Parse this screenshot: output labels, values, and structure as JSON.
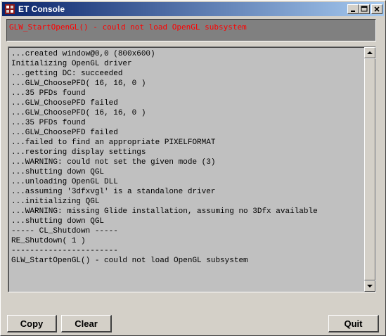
{
  "window": {
    "title": "ET Console",
    "icon": "et-app-icon",
    "controls": [
      "minimize-icon",
      "maximize-icon",
      "close-icon"
    ]
  },
  "error_bar": {
    "text": "GLW_StartOpenGL() - could not load OpenGL subsystem",
    "color": "#ff0000"
  },
  "console": {
    "lines": [
      "...created window@0,0 (800x600)",
      "Initializing OpenGL driver",
      "...getting DC: succeeded",
      "...GLW_ChoosePFD( 16, 16, 0 )",
      "...35 PFDs found",
      "...GLW_ChoosePFD failed",
      "...GLW_ChoosePFD( 16, 16, 0 )",
      "...35 PFDs found",
      "...GLW_ChoosePFD failed",
      "...failed to find an appropriate PIXELFORMAT",
      "...restoring display settings",
      "...WARNING: could not set the given mode (3)",
      "...shutting down QGL",
      "...unloading OpenGL DLL",
      "...assuming '3dfxvgl' is a standalone driver",
      "...initializing QGL",
      "...WARNING: missing Glide installation, assuming no 3Dfx available",
      "...shutting down QGL",
      "----- CL_Shutdown -----",
      "RE_Shutdown( 1 )",
      "-----------------------",
      "GLW_StartOpenGL() - could not load OpenGL subsystem"
    ]
  },
  "buttons": {
    "copy": "Copy",
    "clear": "Clear",
    "quit": "Quit"
  }
}
